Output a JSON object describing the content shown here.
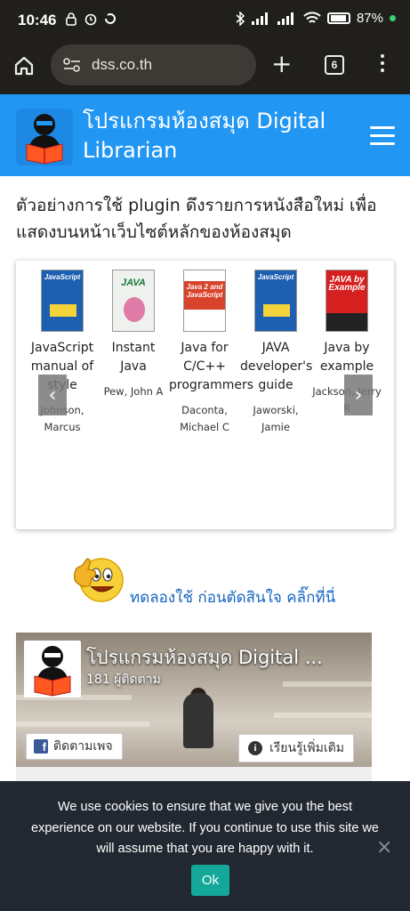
{
  "status_bar": {
    "time": "10:46",
    "battery": "87%"
  },
  "browser": {
    "url": "dss.co.th",
    "tab_count": "6"
  },
  "site": {
    "title": "โปรแกรมห้องสมุด Digital Librarian"
  },
  "intro": "ตัวอย่างการใช้ plugin ดึงรายการหนังสือใหม่ เพื่อแสดงบนหน้าเว็บไซต์หลักของห้องสมุด",
  "books": [
    {
      "title": "JavaScript manual of style",
      "author": "Johnson, Marcus",
      "cover_text": "JavaScript",
      "cover_color": "#1d5fb0"
    },
    {
      "title": "Instant Java",
      "author": "Pew, John A",
      "cover_text": "JAVA",
      "cover_color": "#eef1ee"
    },
    {
      "title": "Java for C/C++ programmers",
      "author": "Daconta, Michael C",
      "cover_text": "Java 2 and JavaScript",
      "cover_color": "#d8432b"
    },
    {
      "title": "JAVA developer's guide",
      "author": "Jaworski, Jamie",
      "cover_text": "JavaScript",
      "cover_color": "#1d5fb0"
    },
    {
      "title": "Java by example",
      "author": "Jackson, Jerry R",
      "cover_text": "JAVA by Example",
      "cover_color": "#d61f1f"
    }
  ],
  "carousel": {
    "prev": "‹",
    "next": "›"
  },
  "cta": {
    "text": "ทดลองใช้ ก่อนตัดสินใจ คลิ๊กที่นี่"
  },
  "facebook": {
    "page_name": "โปรแกรมห้องสมุด Digital ...",
    "followers": "181 ผู้ติดตาม",
    "follow_label": "ติดตามเพจ",
    "learn_more_label": "เรียนรู้เพิ่มเติม"
  },
  "cookie": {
    "message": "We use cookies to ensure that we give you the best experience on our website. If you continue to use this site we will assume that you are happy with it.",
    "ok_label": "Ok",
    "close": "×"
  }
}
